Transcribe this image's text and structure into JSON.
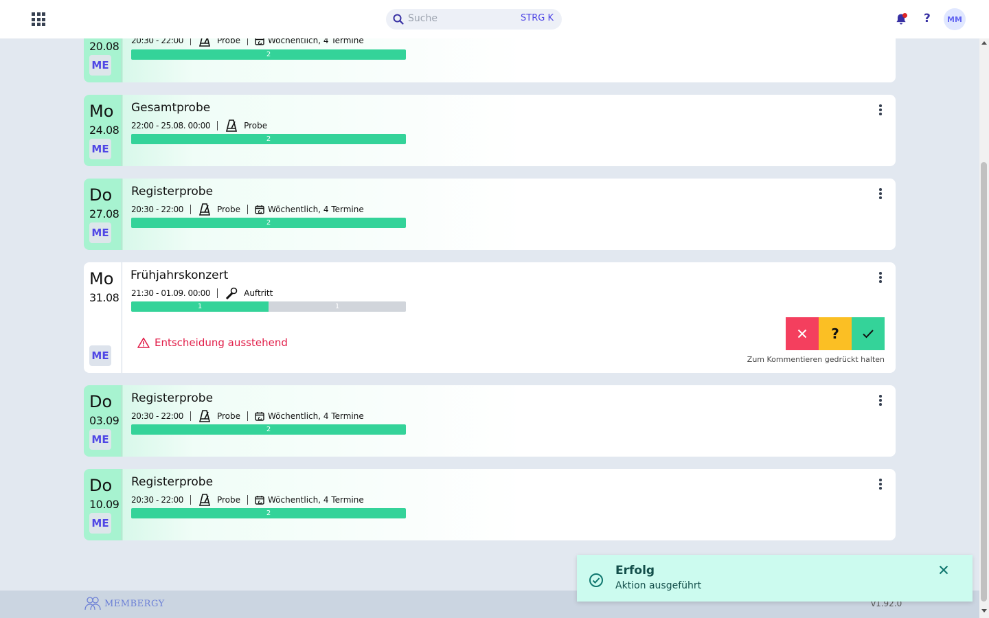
{
  "header": {
    "search_placeholder": "Suche",
    "search_shortcut": "STRG K",
    "avatar_initials": "MM",
    "help_label": "?",
    "notification_dot": true
  },
  "events": [
    {
      "weekday": "",
      "date": "20.08",
      "title": "",
      "time": "20:30 - 22:00",
      "type": "Probe",
      "recurrence": "Wöchentlich, 4 Termine",
      "badge": "ME",
      "state": "accepted",
      "bar": [
        {
          "value": "2",
          "fraction": 1.0,
          "color": "green"
        }
      ]
    },
    {
      "weekday": "Mo",
      "date": "24.08",
      "title": "Gesamtprobe",
      "time": "22:00 - 25.08. 00:00",
      "type": "Probe",
      "recurrence": "",
      "badge": "ME",
      "state": "accepted",
      "bar": [
        {
          "value": "2",
          "fraction": 1.0,
          "color": "green"
        }
      ]
    },
    {
      "weekday": "Do",
      "date": "27.08",
      "title": "Registerprobe",
      "time": "20:30 - 22:00",
      "type": "Probe",
      "recurrence": "Wöchentlich, 4 Termine",
      "badge": "ME",
      "state": "accepted",
      "bar": [
        {
          "value": "2",
          "fraction": 1.0,
          "color": "green"
        }
      ]
    },
    {
      "weekday": "Mo",
      "date": "31.08",
      "title": "Frühjahrskonzert",
      "time": "21:30 - 01.09. 00:00",
      "type": "Auftritt",
      "recurrence": "",
      "badge": "ME",
      "state": "pending",
      "pending_text": "Entscheidung ausstehend",
      "hold_hint": "Zum Kommentieren gedrückt halten",
      "maybe_label": "?",
      "bar": [
        {
          "value": "1",
          "fraction": 0.5,
          "color": "green"
        },
        {
          "value": "1",
          "fraction": 0.5,
          "color": "gray"
        }
      ]
    },
    {
      "weekday": "Do",
      "date": "03.09",
      "title": "Registerprobe",
      "time": "20:30 - 22:00",
      "type": "Probe",
      "recurrence": "Wöchentlich, 4 Termine",
      "badge": "ME",
      "state": "accepted",
      "bar": [
        {
          "value": "2",
          "fraction": 1.0,
          "color": "green"
        }
      ]
    },
    {
      "weekday": "Do",
      "date": "10.09",
      "title": "Registerprobe",
      "time": "20:30 - 22:00",
      "type": "Probe",
      "recurrence": "Wöchentlich, 4 Termine",
      "badge": "ME",
      "state": "accepted",
      "bar": [
        {
          "value": "2",
          "fraction": 1.0,
          "color": "green"
        }
      ]
    }
  ],
  "footer": {
    "brand": "MEMBERGY",
    "version": "v1.92.0"
  },
  "toast": {
    "title": "Erfolg",
    "message": "Aktion ausgeführt"
  },
  "colors": {
    "accent": "#4f46e5",
    "success": "#34d399",
    "decline": "#f43f5e",
    "maybe": "#fbbf24",
    "warning_text": "#e11d48",
    "toast_bg": "#ccfbef"
  }
}
